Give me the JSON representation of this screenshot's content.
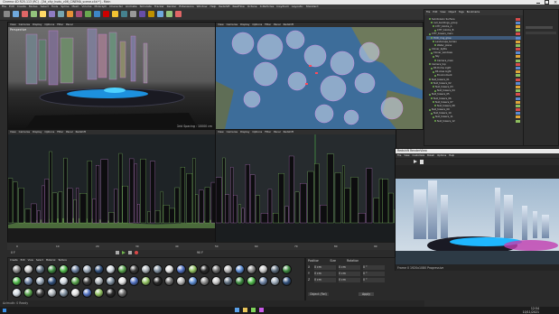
{
  "window": {
    "title": "Cinema 4D R25.113 (RC) - [3d_city_hudu_v06_CINEMA_scene.c4d *] - Main",
    "controls": [
      "minimize-icon",
      "maximize-icon",
      "close-icon"
    ]
  },
  "menubar": {
    "items": [
      "File",
      "Edit",
      "Create",
      "Modes",
      "Select",
      "Tools",
      "Spline",
      "Mesh",
      "Volume",
      "MoGraph",
      "Character",
      "Animate",
      "Simulate",
      "Tracker",
      "Render",
      "Extensions",
      "Window",
      "Help",
      "Redshift",
      "RealFlow",
      "Octane",
      "X-Particles",
      "Insydium",
      "Layouts:",
      "Standard"
    ]
  },
  "viewport_top_left": {
    "menu": [
      "View",
      "Cameras",
      "Display",
      "Options",
      "Filter",
      "Panel"
    ],
    "label": "Perspective",
    "footer": "Grid Spacing : 10000 cm"
  },
  "viewport_top_right": {
    "menu": [
      "View",
      "Cameras",
      "Display",
      "Options",
      "Filter",
      "Panel",
      "Redshift"
    ],
    "label": "Top"
  },
  "viewport_bottom_left": {
    "menu": [
      "View",
      "Cameras",
      "Display",
      "Options",
      "Filter",
      "Panel",
      "Redshift"
    ],
    "label": "Front"
  },
  "viewport_bottom_mid": {
    "menu": [
      "View",
      "Cameras",
      "Display",
      "Options",
      "Filter",
      "Panel",
      "Redshift"
    ],
    "label": "Right"
  },
  "object_manager": {
    "menu": [
      "File",
      "Edit",
      "View",
      "Object",
      "Tags",
      "Bookmarks"
    ],
    "objects": [
      "Subdivision Surface",
      "null_buildings_group",
      "CITY_blocks_A",
      "CITY_blocks_B",
      "CITY_towers_main",
      "HUD_ring_glow",
      "Landscape_terrain",
      "Water_plane",
      "Cloner_lights",
      "Cloner_windows",
      "Sky",
      "Camera_main",
      "Camera_top",
      "RS Dome Light",
      "RS Area Light",
      "Environment",
      "Null_towers_01",
      "Null_towers_02",
      "Null_towers_03",
      "Null_towers_04",
      "Null_towers_05",
      "Null_towers_06",
      "Null_towers_07",
      "Null_towers_08",
      "Null_towers_09",
      "Null_towers_10",
      "Null_towers_11",
      "Null_towers_12"
    ]
  },
  "render_view": {
    "title": "Redshift RenderView",
    "menu": [
      "File",
      "View",
      "Customize",
      "Bokeh",
      "Options",
      "Help"
    ],
    "status": "Frame 0  1920x1080  Progressive"
  },
  "timeline": {
    "frames": [
      "0",
      "10",
      "20",
      "30",
      "40",
      "50",
      "60",
      "70",
      "80",
      "90"
    ],
    "current_frame": "0 F",
    "end_frame": "90 F"
  },
  "material_manager": {
    "menu": [
      "Create",
      "Edit",
      "View",
      "Select",
      "Material",
      "Texture"
    ],
    "material_colors": [
      "#8a8a8a",
      "#c9c9c9",
      "#5b6b7c",
      "#3c8a3f",
      "#4fb84a",
      "#6a7fa0",
      "#9aa8b8",
      "#2f4e7a",
      "#cfd7df",
      "#57a24b",
      "#3b3b3b",
      "#aab1b7",
      "#7f8f9f",
      "#e0e0e0",
      "#4f6fbf",
      "#8fbf5f",
      "#2a2a2a",
      "#6c6c6c",
      "#b5b5b5",
      "#5a8ad0"
    ]
  },
  "coordinates": {
    "headers": [
      "Position",
      "Size",
      "Rotation"
    ],
    "rows": [
      {
        "axis": "X",
        "pos": "0 cm",
        "size": "0 cm",
        "rot": "0 °"
      },
      {
        "axis": "Y",
        "pos": "0 cm",
        "size": "0 cm",
        "rot": "0 °"
      },
      {
        "axis": "Z",
        "pos": "0 cm",
        "size": "0 cm",
        "rot": "0 °"
      }
    ],
    "mode": "Object (Rel)",
    "apply": "Apply"
  },
  "statusbar": {
    "text": "Azimuth: 0  Ready"
  },
  "taskbar": {
    "time": "12:54",
    "date": "10/11/2021"
  }
}
